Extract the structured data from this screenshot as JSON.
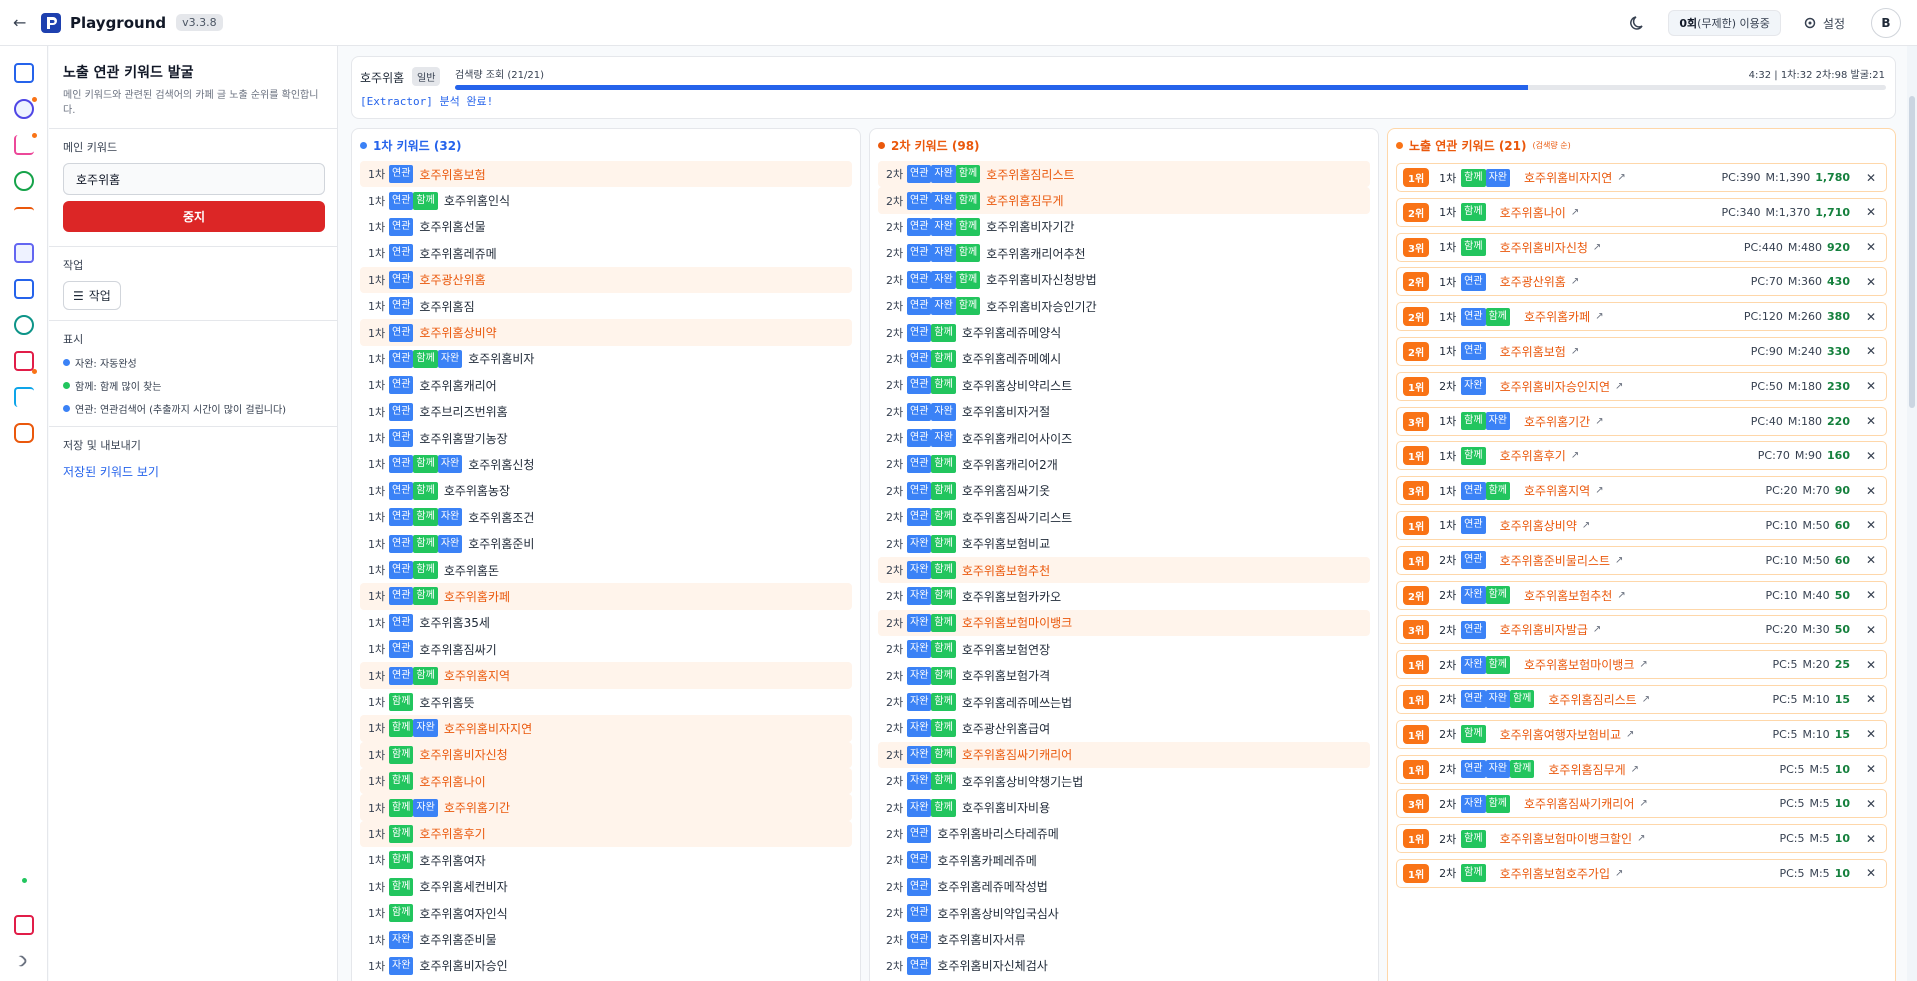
{
  "header": {
    "back": "←",
    "title": "Playground",
    "version": "v3.3.8",
    "usage_count": "0회",
    "usage_suffix": "(무제한) 이용중",
    "settings_label": "설정",
    "avatar": "B"
  },
  "side": {
    "title": "노출 연관 키워드 발굴",
    "desc": "메인 키워드와 관련된 검색어의 카페 글 노출 순위를 확인합니다.",
    "main_kw_label": "메인 키워드",
    "main_kw_value": "호주위홈",
    "stop_label": "중지",
    "task_section": "작업",
    "task_btn": "작업",
    "display_section": "표시",
    "legend": [
      {
        "text": "자완: 자동완성",
        "color": "#3b82f6"
      },
      {
        "text": "함께: 함께 많이 찾는",
        "color": "#22c55e"
      },
      {
        "text": "연관: 연관검색어   (추출까지 시간이 많이 걸립니다)",
        "color": "#3b82f6"
      }
    ],
    "save_section": "저장 및 내보내기",
    "saved_link": "저장된 키워드 보기"
  },
  "progress": {
    "keyword": "호주위홈",
    "badge": "일반",
    "status": "검색량 조회 (21/21)",
    "time": "4:32 | 1차:32 2차:98 발굴:21",
    "fraction": 0.75,
    "log": "[Extractor] 분석 완료!"
  },
  "col1": {
    "title": "1차 키워드 (32)",
    "color": "#3b82f6",
    "rows": [
      {
        "lvl": "1차",
        "tags": [
          "연관"
        ],
        "kw": "호주위홈보험",
        "hl": true
      },
      {
        "lvl": "1차",
        "tags": [
          "연관",
          "함께"
        ],
        "kw": "호주위홈인식",
        "hl": false
      },
      {
        "lvl": "1차",
        "tags": [
          "연관"
        ],
        "kw": "호주위홈선물",
        "hl": false
      },
      {
        "lvl": "1차",
        "tags": [
          "연관"
        ],
        "kw": "호주위홈레쥬메",
        "hl": false
      },
      {
        "lvl": "1차",
        "tags": [
          "연관"
        ],
        "kw": "호주광산위홈",
        "hl": true
      },
      {
        "lvl": "1차",
        "tags": [
          "연관"
        ],
        "kw": "호주위홈짐",
        "hl": false
      },
      {
        "lvl": "1차",
        "tags": [
          "연관"
        ],
        "kw": "호주위홈상비약",
        "hl": true
      },
      {
        "lvl": "1차",
        "tags": [
          "연관",
          "함께",
          "자완"
        ],
        "kw": "호주위홈비자",
        "hl": false
      },
      {
        "lvl": "1차",
        "tags": [
          "연관"
        ],
        "kw": "호주위홈캐리어",
        "hl": false
      },
      {
        "lvl": "1차",
        "tags": [
          "연관"
        ],
        "kw": "호주브리즈번위홈",
        "hl": false
      },
      {
        "lvl": "1차",
        "tags": [
          "연관"
        ],
        "kw": "호주위홈딸기농장",
        "hl": false
      },
      {
        "lvl": "1차",
        "tags": [
          "연관",
          "함께",
          "자완"
        ],
        "kw": "호주위홈신청",
        "hl": false
      },
      {
        "lvl": "1차",
        "tags": [
          "연관",
          "함께"
        ],
        "kw": "호주위홈농장",
        "hl": false
      },
      {
        "lvl": "1차",
        "tags": [
          "연관",
          "함께",
          "자완"
        ],
        "kw": "호주위홈조건",
        "hl": false
      },
      {
        "lvl": "1차",
        "tags": [
          "연관",
          "함께",
          "자완"
        ],
        "kw": "호주위홈준비",
        "hl": false
      },
      {
        "lvl": "1차",
        "tags": [
          "연관",
          "함께"
        ],
        "kw": "호주위홈돈",
        "hl": false
      },
      {
        "lvl": "1차",
        "tags": [
          "연관",
          "함께"
        ],
        "kw": "호주위홈카페",
        "hl": true
      },
      {
        "lvl": "1차",
        "tags": [
          "연관"
        ],
        "kw": "호주위홈35세",
        "hl": false
      },
      {
        "lvl": "1차",
        "tags": [
          "연관"
        ],
        "kw": "호주위홈짐싸기",
        "hl": false
      },
      {
        "lvl": "1차",
        "tags": [
          "연관",
          "함께"
        ],
        "kw": "호주위홈지역",
        "hl": true
      },
      {
        "lvl": "1차",
        "tags": [
          "함께"
        ],
        "kw": "호주위홈뜻",
        "hl": false
      },
      {
        "lvl": "1차",
        "tags": [
          "함께",
          "자완"
        ],
        "kw": "호주위홈비자지연",
        "hl": true
      },
      {
        "lvl": "1차",
        "tags": [
          "함께"
        ],
        "kw": "호주위홈비자신청",
        "hl": true
      },
      {
        "lvl": "1차",
        "tags": [
          "함께"
        ],
        "kw": "호주위홈나이",
        "hl": true
      },
      {
        "lvl": "1차",
        "tags": [
          "함께",
          "자완"
        ],
        "kw": "호주위홈기간",
        "hl": true
      },
      {
        "lvl": "1차",
        "tags": [
          "함께"
        ],
        "kw": "호주위홈후기",
        "hl": true
      },
      {
        "lvl": "1차",
        "tags": [
          "함께"
        ],
        "kw": "호주위홈여자",
        "hl": false
      },
      {
        "lvl": "1차",
        "tags": [
          "함께"
        ],
        "kw": "호주위홈세컨비자",
        "hl": false
      },
      {
        "lvl": "1차",
        "tags": [
          "함께"
        ],
        "kw": "호주위홈여자인식",
        "hl": false
      },
      {
        "lvl": "1차",
        "tags": [
          "자완"
        ],
        "kw": "호주위홈준비물",
        "hl": false
      },
      {
        "lvl": "1차",
        "tags": [
          "자완"
        ],
        "kw": "호주위홈비자승인",
        "hl": false
      }
    ]
  },
  "col2": {
    "title": "2차 키워드 (98)",
    "color": "#ea580c",
    "rows": [
      {
        "lvl": "2차",
        "tags": [
          "연관",
          "자완",
          "함께"
        ],
        "kw": "호주위홈짐리스트",
        "hl": true
      },
      {
        "lvl": "2차",
        "tags": [
          "연관",
          "자완",
          "함께"
        ],
        "kw": "호주위홈짐무게",
        "hl": true
      },
      {
        "lvl": "2차",
        "tags": [
          "연관",
          "자완",
          "함께"
        ],
        "kw": "호주위홈비자기간",
        "hl": false
      },
      {
        "lvl": "2차",
        "tags": [
          "연관",
          "자완",
          "함께"
        ],
        "kw": "호주위홈캐리어추천",
        "hl": false
      },
      {
        "lvl": "2차",
        "tags": [
          "연관",
          "자완",
          "함께"
        ],
        "kw": "호주위홈비자신청방법",
        "hl": false
      },
      {
        "lvl": "2차",
        "tags": [
          "연관",
          "자완",
          "함께"
        ],
        "kw": "호주위홈비자승인기간",
        "hl": false
      },
      {
        "lvl": "2차",
        "tags": [
          "연관",
          "함께"
        ],
        "kw": "호주위홈레쥬메양식",
        "hl": false
      },
      {
        "lvl": "2차",
        "tags": [
          "연관",
          "함께"
        ],
        "kw": "호주위홈레쥬메예시",
        "hl": false
      },
      {
        "lvl": "2차",
        "tags": [
          "연관",
          "함께"
        ],
        "kw": "호주위홈상비약리스트",
        "hl": false
      },
      {
        "lvl": "2차",
        "tags": [
          "연관",
          "자완"
        ],
        "kw": "호주위홈비자거절",
        "hl": false
      },
      {
        "lvl": "2차",
        "tags": [
          "연관",
          "자완"
        ],
        "kw": "호주위홈캐리어사이즈",
        "hl": false
      },
      {
        "lvl": "2차",
        "tags": [
          "연관",
          "함께"
        ],
        "kw": "호주위홈캐리어2개",
        "hl": false
      },
      {
        "lvl": "2차",
        "tags": [
          "연관",
          "함께"
        ],
        "kw": "호주위홈짐싸기옷",
        "hl": false
      },
      {
        "lvl": "2차",
        "tags": [
          "연관",
          "함께"
        ],
        "kw": "호주위홈짐싸기리스트",
        "hl": false
      },
      {
        "lvl": "2차",
        "tags": [
          "자완",
          "함께"
        ],
        "kw": "호주위홈보험비교",
        "hl": false
      },
      {
        "lvl": "2차",
        "tags": [
          "자완",
          "함께"
        ],
        "kw": "호주위홈보험추천",
        "hl": true
      },
      {
        "lvl": "2차",
        "tags": [
          "자완",
          "함께"
        ],
        "kw": "호주위홈보험카카오",
        "hl": false
      },
      {
        "lvl": "2차",
        "tags": [
          "자완",
          "함께"
        ],
        "kw": "호주위홈보험마이뱅크",
        "hl": true
      },
      {
        "lvl": "2차",
        "tags": [
          "자완",
          "함께"
        ],
        "kw": "호주위홈보험연장",
        "hl": false
      },
      {
        "lvl": "2차",
        "tags": [
          "자완",
          "함께"
        ],
        "kw": "호주위홈보험가격",
        "hl": false
      },
      {
        "lvl": "2차",
        "tags": [
          "자완",
          "함께"
        ],
        "kw": "호주위홈레쥬메쓰는법",
        "hl": false
      },
      {
        "lvl": "2차",
        "tags": [
          "자완",
          "함께"
        ],
        "kw": "호주광산위홈급여",
        "hl": false
      },
      {
        "lvl": "2차",
        "tags": [
          "자완",
          "함께"
        ],
        "kw": "호주위홈짐싸기캐리어",
        "hl": true
      },
      {
        "lvl": "2차",
        "tags": [
          "자완",
          "함께"
        ],
        "kw": "호주위홈상비약챙기는법",
        "hl": false
      },
      {
        "lvl": "2차",
        "tags": [
          "자완",
          "함께"
        ],
        "kw": "호주위홈비자비용",
        "hl": false
      },
      {
        "lvl": "2차",
        "tags": [
          "연관"
        ],
        "kw": "호주위홈바리스타레쥬메",
        "hl": false
      },
      {
        "lvl": "2차",
        "tags": [
          "연관"
        ],
        "kw": "호주위홈카페레쥬메",
        "hl": false
      },
      {
        "lvl": "2차",
        "tags": [
          "연관"
        ],
        "kw": "호주위홈레쥬메작성법",
        "hl": false
      },
      {
        "lvl": "2차",
        "tags": [
          "연관"
        ],
        "kw": "호주위홈상비약입국심사",
        "hl": false
      },
      {
        "lvl": "2차",
        "tags": [
          "연관"
        ],
        "kw": "호주위홈비자서류",
        "hl": false
      },
      {
        "lvl": "2차",
        "tags": [
          "연관"
        ],
        "kw": "호주위홈비자신체검사",
        "hl": false
      }
    ]
  },
  "col3": {
    "title": "노출 연관 키워드 (21)",
    "sub": "(검색량 순)",
    "color": "#f97316",
    "rows": [
      {
        "rank": "1위",
        "lvl": "1차",
        "tags": [
          "함께",
          "자완"
        ],
        "kw": "호주위홈비자지연",
        "pc": "PC:390",
        "m": "M:1,390",
        "total": "1,780"
      },
      {
        "rank": "2위",
        "lvl": "1차",
        "tags": [
          "함께"
        ],
        "kw": "호주위홈나이",
        "pc": "PC:340",
        "m": "M:1,370",
        "total": "1,710"
      },
      {
        "rank": "3위",
        "lvl": "1차",
        "tags": [
          "함께"
        ],
        "kw": "호주위홈비자신청",
        "pc": "PC:440",
        "m": "M:480",
        "total": "920"
      },
      {
        "rank": "2위",
        "lvl": "1차",
        "tags": [
          "연관"
        ],
        "kw": "호주광산위홈",
        "pc": "PC:70",
        "m": "M:360",
        "total": "430"
      },
      {
        "rank": "2위",
        "lvl": "1차",
        "tags": [
          "연관",
          "함께"
        ],
        "kw": "호주위홈카페",
        "pc": "PC:120",
        "m": "M:260",
        "total": "380"
      },
      {
        "rank": "2위",
        "lvl": "1차",
        "tags": [
          "연관"
        ],
        "kw": "호주위홈보험",
        "pc": "PC:90",
        "m": "M:240",
        "total": "330"
      },
      {
        "rank": "1위",
        "lvl": "2차",
        "tags": [
          "자완"
        ],
        "kw": "호주위홈비자승인지연",
        "pc": "PC:50",
        "m": "M:180",
        "total": "230"
      },
      {
        "rank": "3위",
        "lvl": "1차",
        "tags": [
          "함께",
          "자완"
        ],
        "kw": "호주위홈기간",
        "pc": "PC:40",
        "m": "M:180",
        "total": "220"
      },
      {
        "rank": "1위",
        "lvl": "1차",
        "tags": [
          "함께"
        ],
        "kw": "호주위홈후기",
        "pc": "PC:70",
        "m": "M:90",
        "total": "160"
      },
      {
        "rank": "3위",
        "lvl": "1차",
        "tags": [
          "연관",
          "함께"
        ],
        "kw": "호주위홈지역",
        "pc": "PC:20",
        "m": "M:70",
        "total": "90"
      },
      {
        "rank": "1위",
        "lvl": "1차",
        "tags": [
          "연관"
        ],
        "kw": "호주위홈상비약",
        "pc": "PC:10",
        "m": "M:50",
        "total": "60"
      },
      {
        "rank": "1위",
        "lvl": "2차",
        "tags": [
          "연관"
        ],
        "kw": "호주위홈준비물리스트",
        "pc": "PC:10",
        "m": "M:50",
        "total": "60"
      },
      {
        "rank": "2위",
        "lvl": "2차",
        "tags": [
          "자완",
          "함께"
        ],
        "kw": "호주위홈보험추천",
        "pc": "PC:10",
        "m": "M:40",
        "total": "50"
      },
      {
        "rank": "3위",
        "lvl": "2차",
        "tags": [
          "연관"
        ],
        "kw": "호주위홈비자발급",
        "pc": "PC:20",
        "m": "M:30",
        "total": "50"
      },
      {
        "rank": "1위",
        "lvl": "2차",
        "tags": [
          "자완",
          "함께"
        ],
        "kw": "호주위홈보험마이뱅크",
        "pc": "PC:5",
        "m": "M:20",
        "total": "25"
      },
      {
        "rank": "1위",
        "lvl": "2차",
        "tags": [
          "연관",
          "자완",
          "함께"
        ],
        "kw": "호주위홈짐리스트",
        "pc": "PC:5",
        "m": "M:10",
        "total": "15"
      },
      {
        "rank": "1위",
        "lvl": "2차",
        "tags": [
          "함께"
        ],
        "kw": "호주위홈여행자보험비교",
        "pc": "PC:5",
        "m": "M:10",
        "total": "15"
      },
      {
        "rank": "1위",
        "lvl": "2차",
        "tags": [
          "연관",
          "자완",
          "함께"
        ],
        "kw": "호주위홈짐무게",
        "pc": "PC:5",
        "m": "M:5",
        "total": "10"
      },
      {
        "rank": "3위",
        "lvl": "2차",
        "tags": [
          "자완",
          "함께"
        ],
        "kw": "호주위홈짐싸기캐리어",
        "pc": "PC:5",
        "m": "M:5",
        "total": "10"
      },
      {
        "rank": "1위",
        "lvl": "2차",
        "tags": [
          "함께"
        ],
        "kw": "호주위홈보험마이뱅크할인",
        "pc": "PC:5",
        "m": "M:5",
        "total": "10"
      },
      {
        "rank": "1위",
        "lvl": "2차",
        "tags": [
          "함께"
        ],
        "kw": "호주위홈보험호주가입",
        "pc": "PC:5",
        "m": "M:5",
        "total": "10"
      }
    ]
  }
}
